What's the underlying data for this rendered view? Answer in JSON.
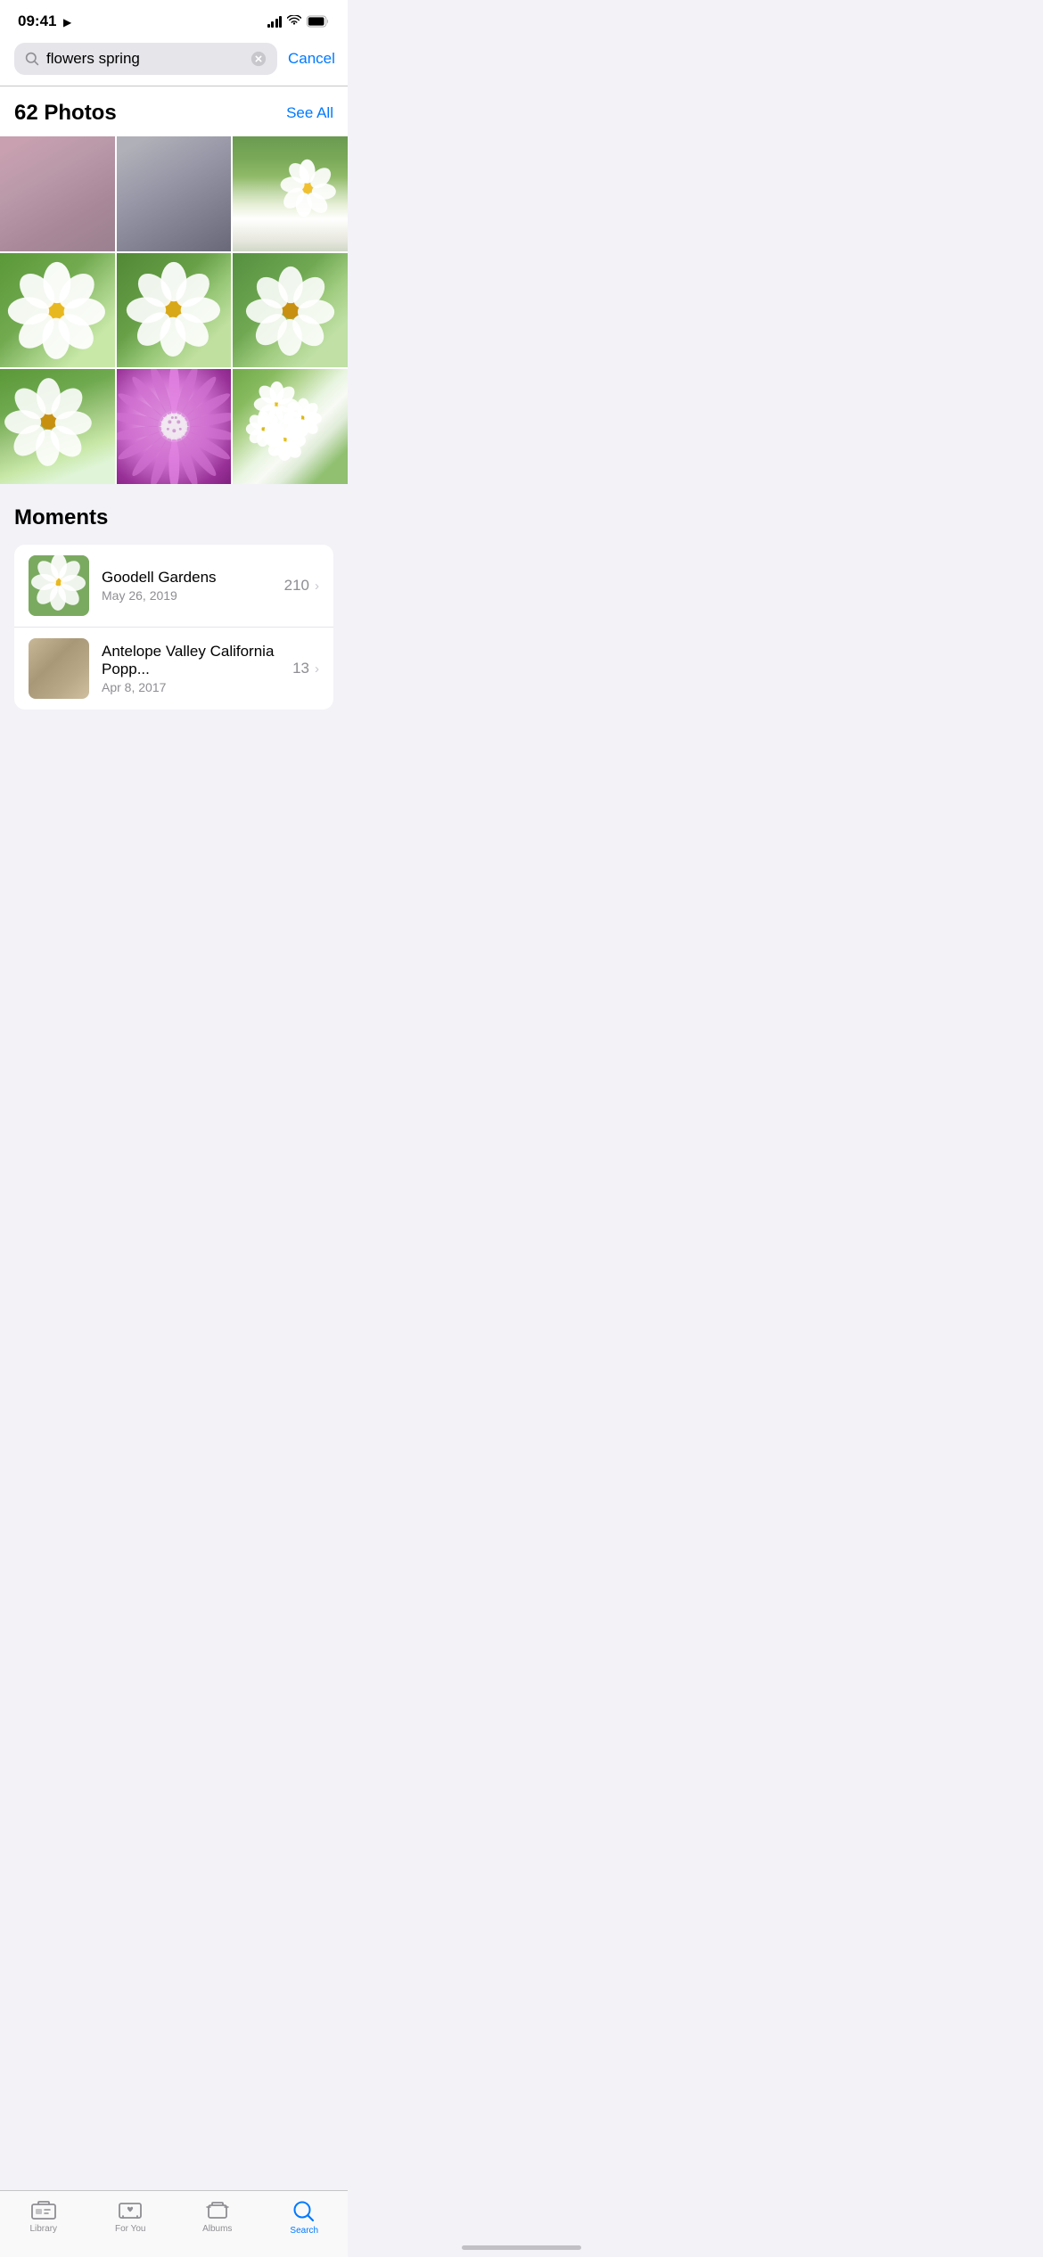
{
  "statusBar": {
    "time": "09:41",
    "locationIcon": "▶"
  },
  "searchBar": {
    "query": "flowers spring",
    "cancelLabel": "Cancel",
    "placeholder": "Search"
  },
  "photosSection": {
    "title": "62 Photos",
    "seeAllLabel": "See All",
    "photoCount": 9
  },
  "momentsSection": {
    "title": "Moments",
    "items": [
      {
        "name": "Goodell Gardens",
        "date": "May 26, 2019",
        "count": "210"
      },
      {
        "name": "Antelope Valley California Popp...",
        "date": "Apr 8, 2017",
        "count": "13"
      }
    ]
  },
  "tabBar": {
    "tabs": [
      {
        "id": "library",
        "label": "Library",
        "active": false
      },
      {
        "id": "for-you",
        "label": "For You",
        "active": false
      },
      {
        "id": "albums",
        "label": "Albums",
        "active": false
      },
      {
        "id": "search",
        "label": "Search",
        "active": true
      }
    ]
  }
}
